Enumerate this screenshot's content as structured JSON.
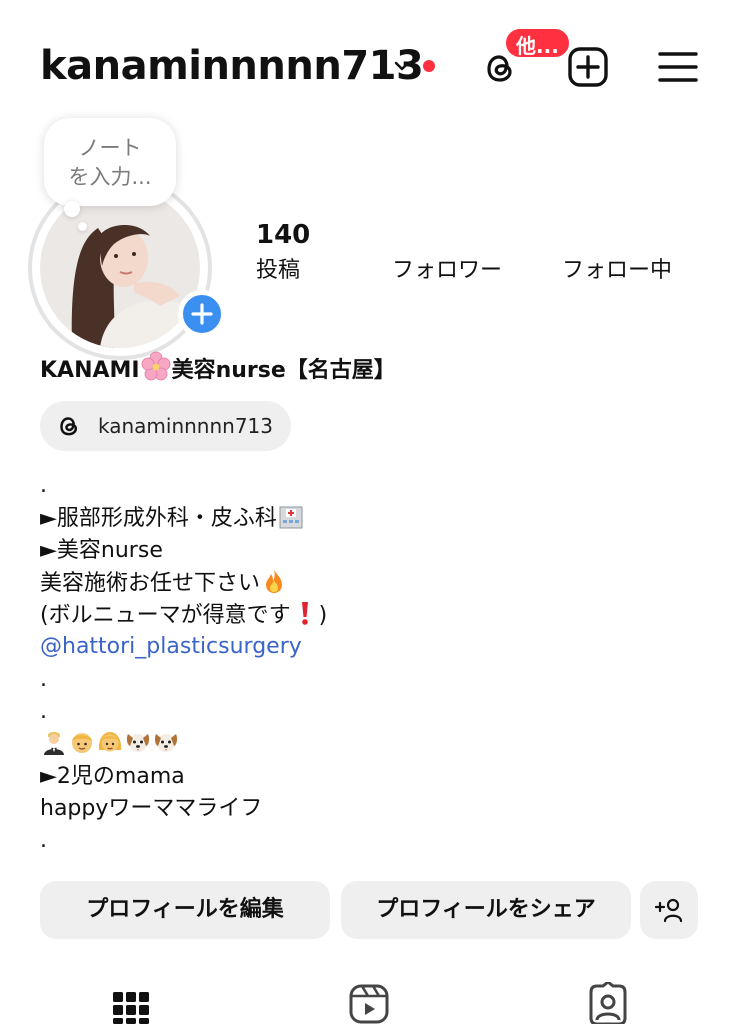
{
  "header": {
    "username": "kanaminnnnn713",
    "threads_badge": "他...",
    "icons": {
      "switch_account": "chevron-down-icon",
      "notification": "red-dot",
      "threads": "threads-icon",
      "create": "plus-square-icon",
      "menu": "hamburger-menu-icon"
    }
  },
  "note": {
    "placeholder_line1": "ノート",
    "placeholder_line2": "を入力..."
  },
  "stats": {
    "posts_count": "140",
    "posts_label": "投稿",
    "followers_count": "",
    "followers_label": "フォロワー",
    "following_count": "",
    "following_label": "フォロー中"
  },
  "profile": {
    "name_prefix": "KANAMI",
    "name_suffix": "美容nurse【名古屋】",
    "threads_handle": "kanaminnnnn713"
  },
  "bio": {
    "line1": ".",
    "line2": "►服部形成外科・皮ふ科",
    "line3": "►美容nurse",
    "line4": "美容施術お任せ下さい",
    "line5_start": "(ボルニューマが得意です",
    "line5_end": ")",
    "line6": "@hattori_plasticsurgery",
    "line7": ".",
    "line8": ".",
    "line10": "►2児のmama",
    "line11": "happyワーママライフ",
    "line12": ".",
    "emojis": [
      "hospital",
      "fire",
      "red-exclamation",
      "man-in-tuxedo",
      "boy",
      "girl",
      "dog",
      "dog"
    ]
  },
  "actions": {
    "edit_profile": "プロフィールを編集",
    "share_profile": "プロフィールをシェア",
    "discover_people": "add-person-icon"
  },
  "tabs": [
    "grid-icon",
    "reels-icon",
    "tagged-icon"
  ],
  "colors": {
    "accent_red": "#ff3040",
    "link_blue": "#3b64c9",
    "button_gray": "#efefef",
    "story_blue": "#3b8ff0"
  }
}
